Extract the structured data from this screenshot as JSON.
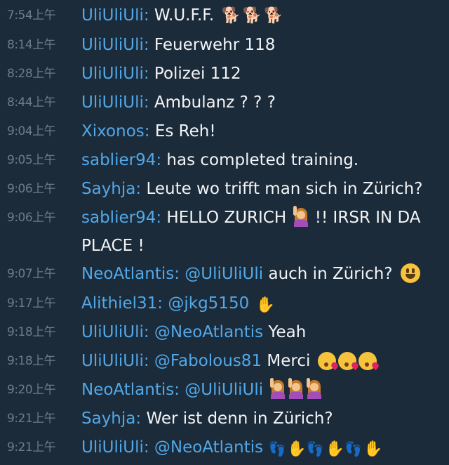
{
  "messages": [
    {
      "time": "7:54上午",
      "user": "UliUliUli:",
      "text": "W.U.F.F."
    },
    {
      "time": "8:14上午",
      "user": "UliUliUli:",
      "text": "Feuerwehr 118"
    },
    {
      "time": "8:28上午",
      "user": "UliUliUli:",
      "text": "Polizei 112"
    },
    {
      "time": "8:44上午",
      "user": "UliUliUli:",
      "text": "Ambulanz ? ? ?"
    },
    {
      "time": "9:04上午",
      "user": "Xixonos:",
      "text": "Es Reh!"
    },
    {
      "time": "9:05上午",
      "user": "sablier94:",
      "text": "has completed training."
    },
    {
      "time": "9:06上午",
      "user": "Sayhja:",
      "text": "Leute wo trifft man sich in Zürich?"
    },
    {
      "time": "9:06上午",
      "user": "sablier94:",
      "text_a": "HELLO ZURICH",
      "text_b": "!! IRSR IN DA",
      "text_c": "PLACE !"
    },
    {
      "time": "9:07上午",
      "user": "NeoAtlantis:",
      "mention": "@UliUliUli",
      "text": "auch in Zürich?"
    },
    {
      "time": "9:17上午",
      "user": "Alithiel31:",
      "mention": "@jkg5150"
    },
    {
      "time": "9:18上午",
      "user": "UliUliUli:",
      "mention": "@NeoAtlantis",
      "text": "Yeah"
    },
    {
      "time": "9:18上午",
      "user": "UliUliUli:",
      "mention": "@Fabolous81",
      "text": "Merci"
    },
    {
      "time": "9:20上午",
      "user": "NeoAtlantis:",
      "mention": "@UliUliUli"
    },
    {
      "time": "9:21上午",
      "user": "Sayhja:",
      "text": "Wer ist denn in Zürich?"
    },
    {
      "time": "9:21上午",
      "user": "UliUliUli:",
      "mention": "@NeoAtlantis"
    }
  ],
  "icons": {
    "dog": "dog-icon",
    "smile": "smiley-face-icon",
    "kiss": "face-blowing-kiss-icon",
    "raising_hand": "person-raising-hand-icon",
    "wave": "waving-hand-icon",
    "feet": "footprints-icon"
  },
  "colors": {
    "background": "#1c2b3a",
    "username": "#52a8e8",
    "timestamp": "#6d7b8a",
    "text": "#f2f4f6"
  }
}
